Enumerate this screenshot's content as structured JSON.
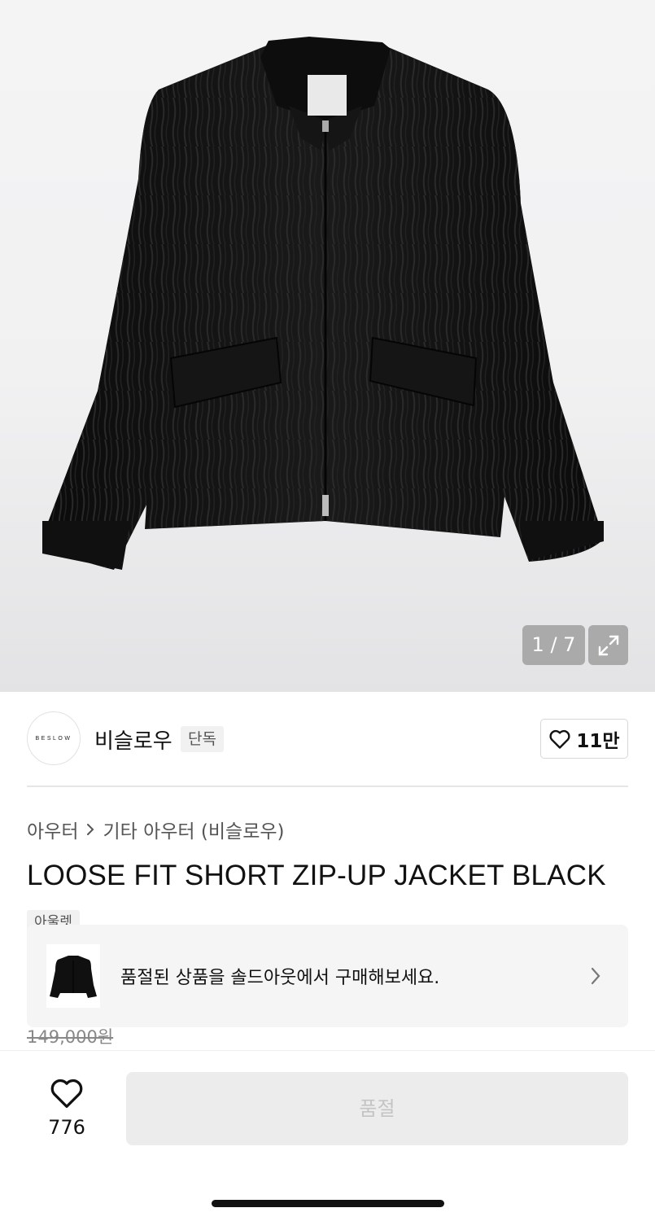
{
  "gallery": {
    "counter": "1 / 7",
    "icons": {
      "expand": "expand-icon"
    }
  },
  "brand": {
    "logo_text": "BESLOW",
    "name": "비슬로우",
    "tag": "단독",
    "likes": "11만",
    "icons": {
      "like": "heart-outline-icon"
    }
  },
  "breadcrumb": {
    "level1": "아우터",
    "separator_icon": "chevron-right-icon",
    "level2": "기타 아우터 (비슬로우)"
  },
  "product": {
    "title": "LOOSE FIT SHORT ZIP-UP JACKET BLACK",
    "badge": "아울렛",
    "original_price": "149,000원"
  },
  "soldout_banner": {
    "text": "품절된 상품을 솔드아웃에서 구매해보세요.",
    "icons": {
      "arrow": "chevron-right-icon"
    }
  },
  "bottom_bar": {
    "wish_count": "776",
    "cta_label": "품절",
    "icons": {
      "wish": "heart-outline-icon"
    }
  },
  "colors": {
    "cta_disabled_bg": "#ececec",
    "cta_disabled_text": "#c4c4c4",
    "banner_bg": "#f5f5f6"
  }
}
